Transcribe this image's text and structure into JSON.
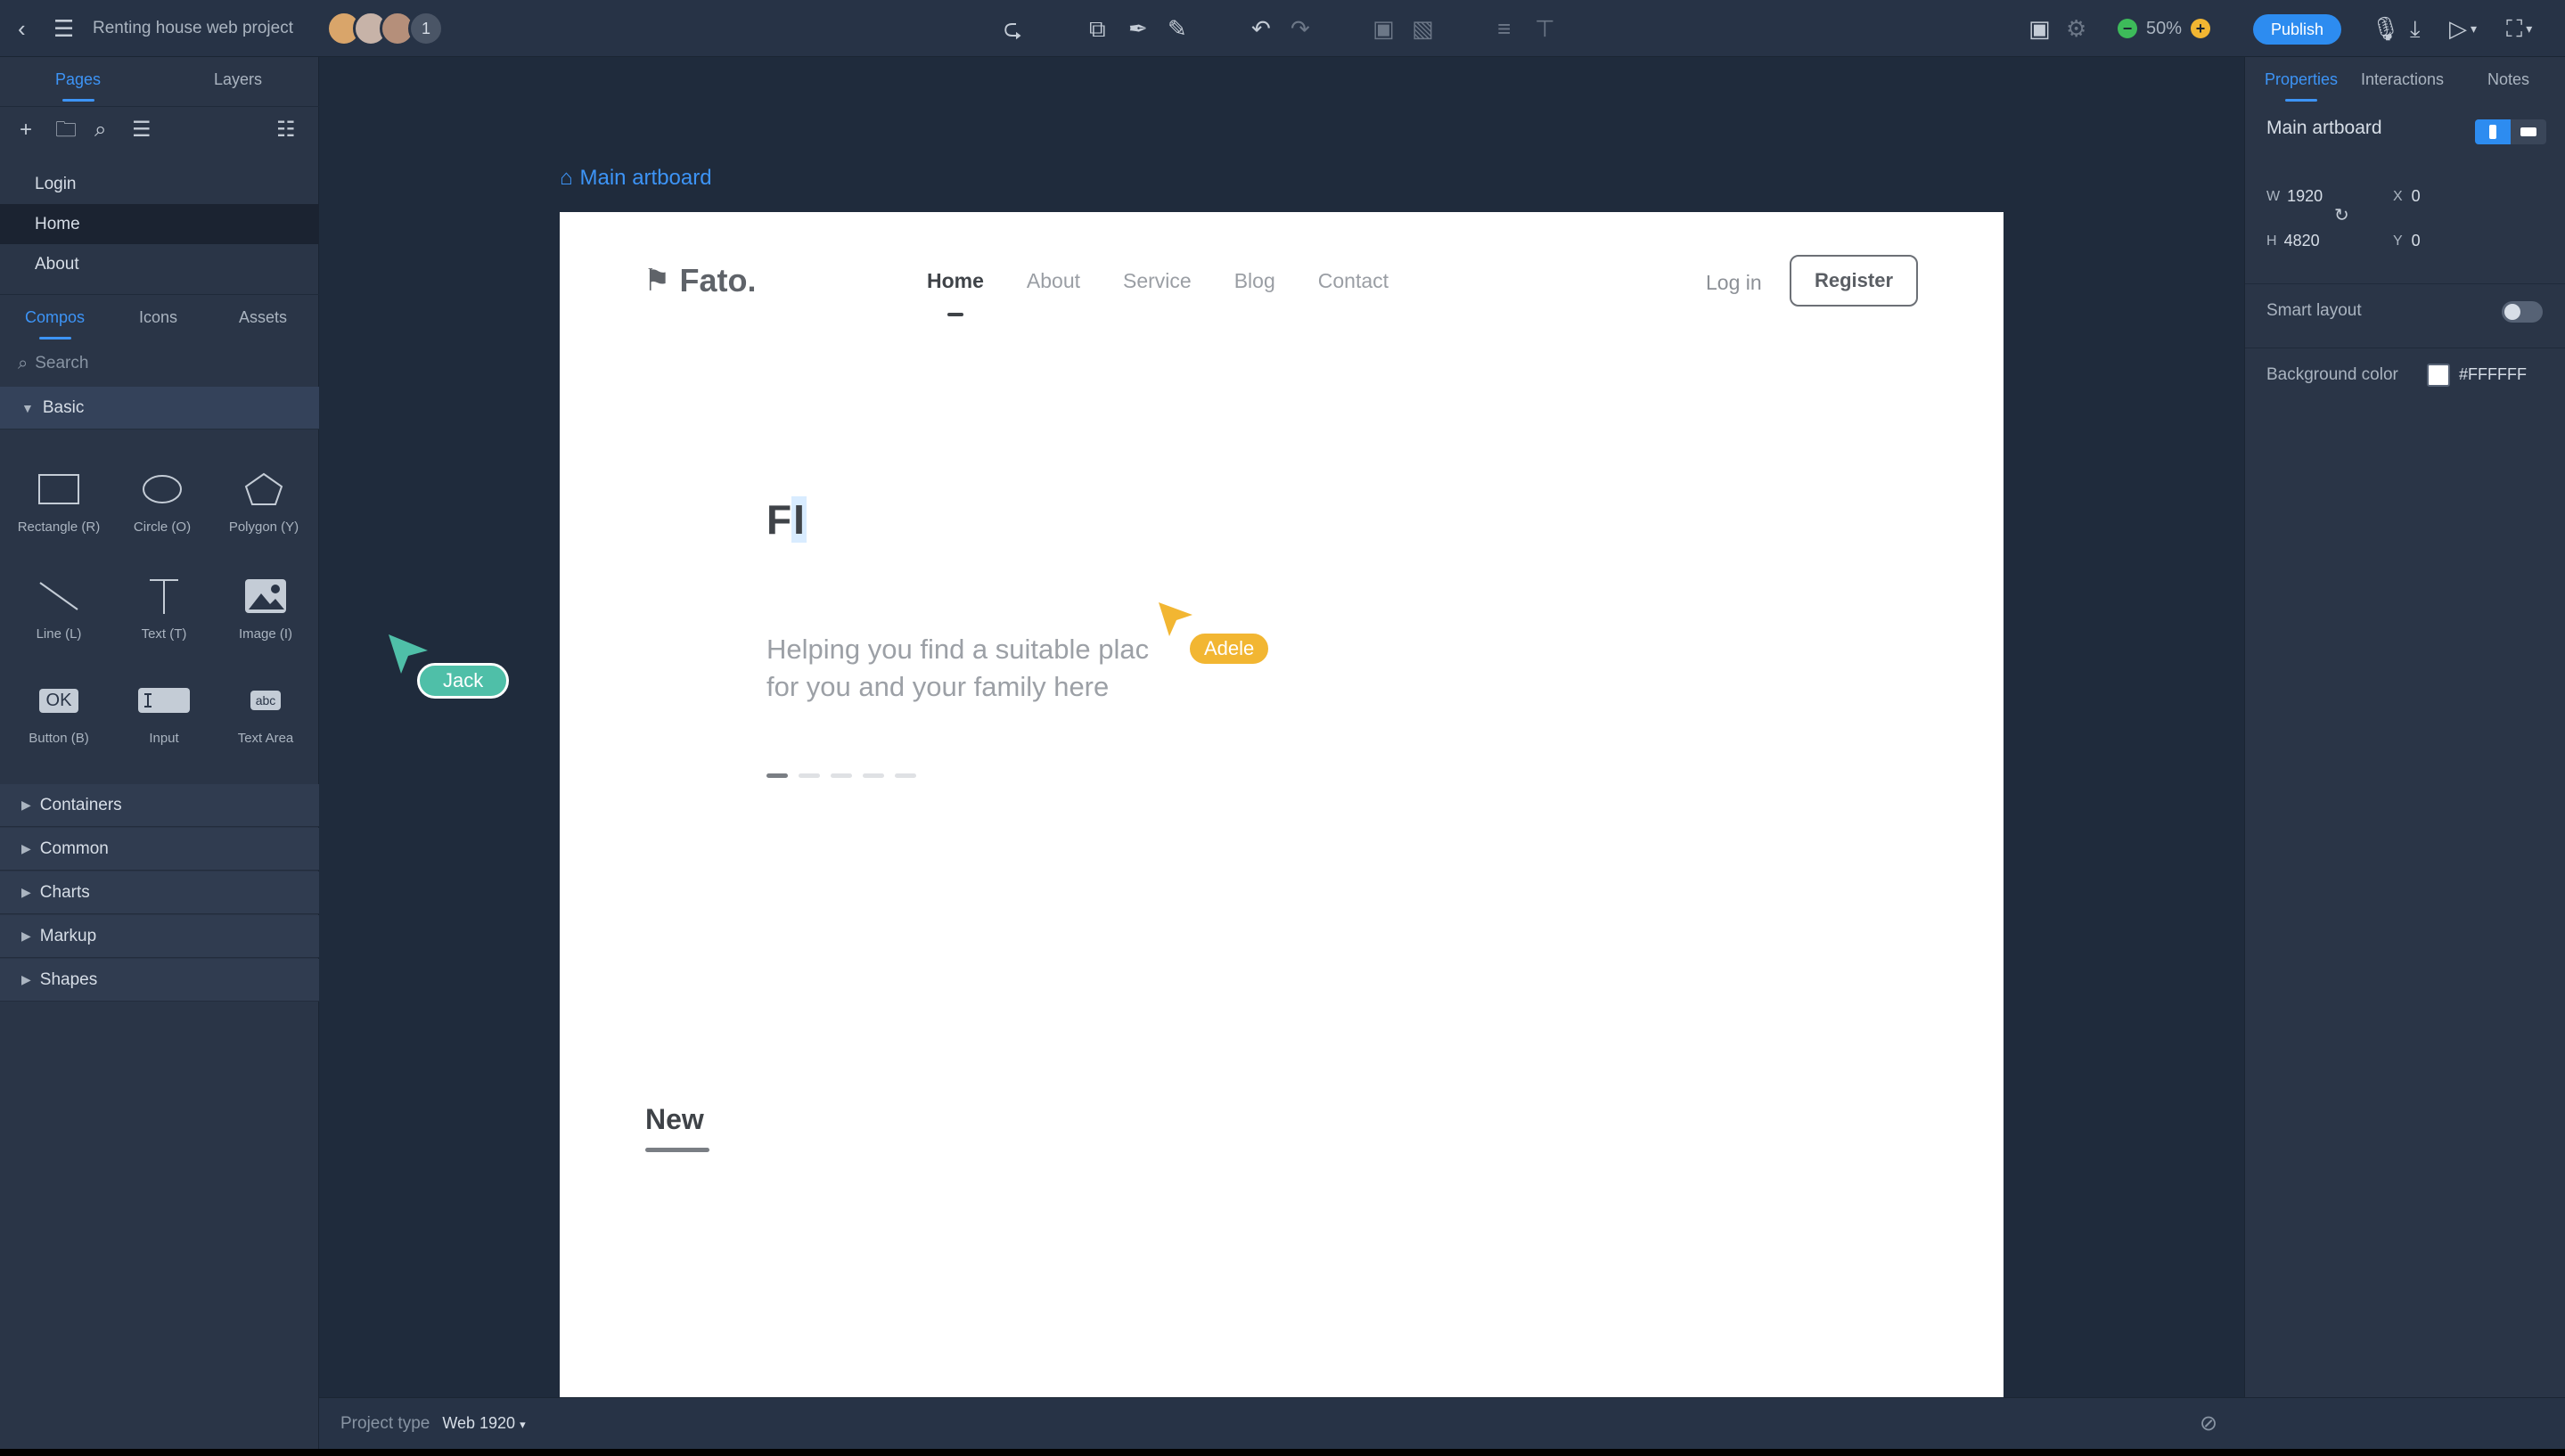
{
  "app": {
    "project_title": "Renting house web project",
    "collaborator_count": "1",
    "zoom": "50%",
    "publish_label": "Publish"
  },
  "left": {
    "tabs": [
      "Pages",
      "Layers"
    ],
    "pages": [
      "Login",
      "Home",
      "About"
    ],
    "selected_page": "Home",
    "compo_tabs": [
      "Compos",
      "Icons",
      "Assets"
    ],
    "search_placeholder": "Search",
    "basic_section": "Basic",
    "components": [
      {
        "label": "Rectangle (R)",
        "icon": "rectangle-icon"
      },
      {
        "label": "Circle (O)",
        "icon": "circle-icon"
      },
      {
        "label": "Polygon (Y)",
        "icon": "polygon-icon"
      },
      {
        "label": "Line (L)",
        "icon": "line-icon"
      },
      {
        "label": "Text (T)",
        "icon": "text-icon"
      },
      {
        "label": "Image (I)",
        "icon": "image-icon"
      },
      {
        "label": "Button (B)",
        "icon": "button-icon",
        "glyph": "OK"
      },
      {
        "label": "Input",
        "icon": "input-icon"
      },
      {
        "label": "Text Area",
        "icon": "textarea-icon",
        "glyph": "abc"
      }
    ],
    "sections": [
      "Containers",
      "Common",
      "Charts",
      "Markup",
      "Shapes"
    ]
  },
  "canvas": {
    "artboard_label": "Main artboard",
    "site": {
      "logo": "Fato.",
      "nav": [
        "Home",
        "About",
        "Service",
        "Blog",
        "Contact"
      ],
      "current_nav": "Home",
      "login": "Log in",
      "register": "Register",
      "hero_title_a": "F",
      "hero_title_b": "I",
      "hero_sub": "Helping you find a suitable plac",
      "hero_sub2": "for you and your family here",
      "new_heading": "New"
    },
    "collaborators": [
      {
        "name": "Jack",
        "color": "#4fbfa8"
      },
      {
        "name": "Adele",
        "color": "#f2b632"
      }
    ]
  },
  "right": {
    "tabs": [
      "Properties",
      "Interactions",
      "Notes"
    ],
    "artboard_name": "Main artboard",
    "w_label": "W",
    "w_value": "1920",
    "h_label": "H",
    "h_value": "4820",
    "x_label": "X",
    "x_value": "0",
    "y_label": "Y",
    "y_value": "0",
    "smart_layout_label": "Smart layout",
    "bg_color_label": "Background color",
    "bg_color_value": "#FFFFFF"
  },
  "bottom": {
    "project_type_label": "Project type",
    "project_type_value": "Web 1920"
  },
  "colors": {
    "accent": "#3d94f6",
    "zoom_minus": "#3dbb5a",
    "zoom_plus": "#f2b632"
  }
}
